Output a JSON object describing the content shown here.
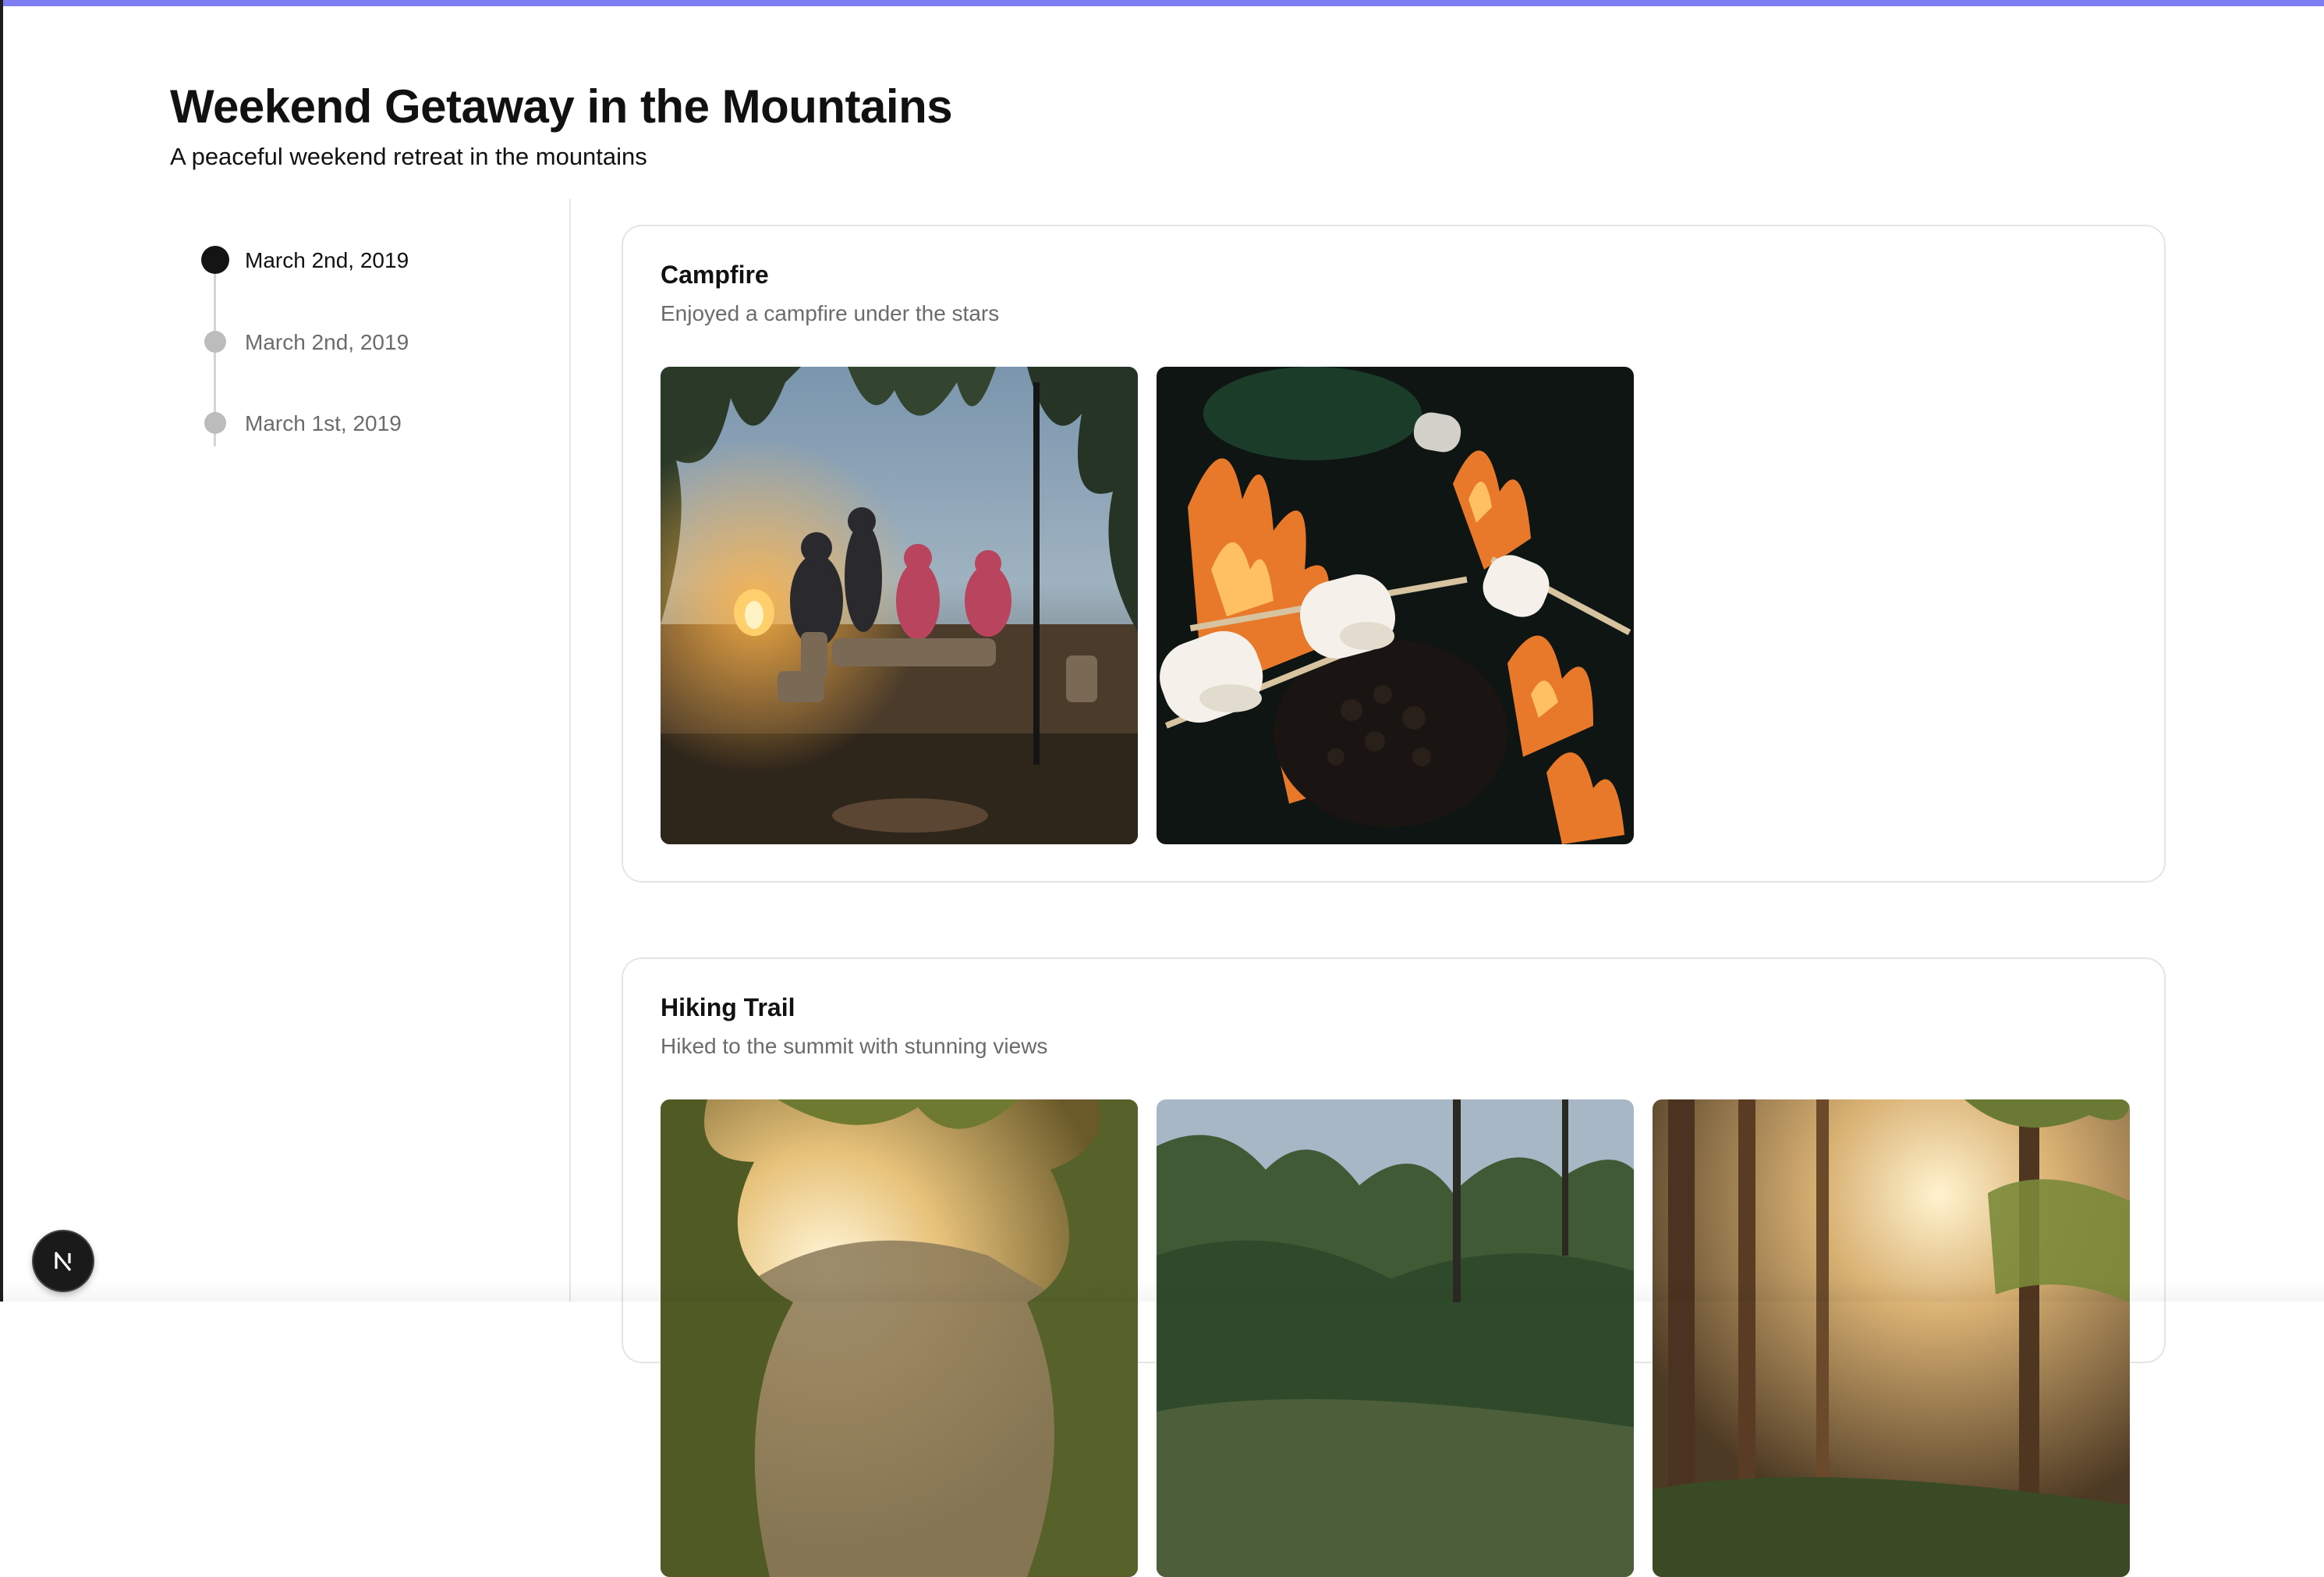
{
  "header": {
    "title": "Weekend Getaway in the Mountains",
    "subtitle": "A peaceful weekend retreat in the mountains"
  },
  "timeline": {
    "items": [
      {
        "label": "March 2nd, 2019",
        "active": true
      },
      {
        "label": "March 2nd, 2019",
        "active": false
      },
      {
        "label": "March 1st, 2019",
        "active": false
      }
    ]
  },
  "events": [
    {
      "title": "Campfire",
      "description": "Enjoyed a campfire under the stars",
      "photos": [
        "campfire-group-photo",
        "roasting-marshmallows-photo"
      ]
    },
    {
      "title": "Hiking Trail",
      "description": "Hiked to the summit with stunning views",
      "photos": [
        "sunlit-valley-photo",
        "forest-trail-photo",
        "sunlit-forest-photo"
      ]
    }
  ],
  "badge": {
    "icon": "nextjs-n-icon",
    "letter": "N"
  },
  "colors": {
    "accent_bar": "#7c7cf5",
    "active_dot": "#141414",
    "inactive_dot": "#bcbcbc",
    "muted_text": "#6b6b6b",
    "card_border": "#e5e5e5"
  }
}
